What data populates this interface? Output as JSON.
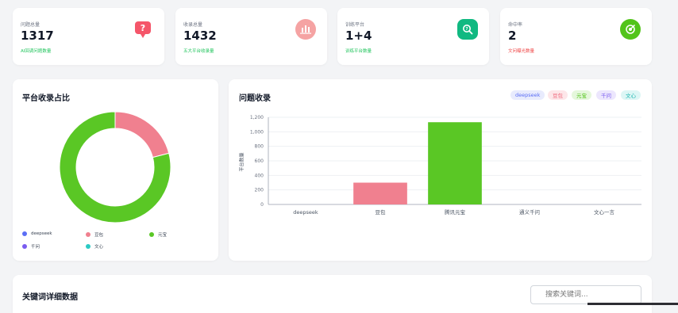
{
  "stats": [
    {
      "label": "问题总量",
      "value": "1317",
      "sub": "AI回调问题数量",
      "sub_color": "#22c55e",
      "icon": "question-bubble-icon",
      "icon_bg": "#f87171"
    },
    {
      "label": "收录总量",
      "value": "1432",
      "sub": "五大平台收录量",
      "sub_color": "#22c55e",
      "icon": "bar-chart-icon",
      "icon_bg": "#f5a3a3"
    },
    {
      "label": "训练平台",
      "value": "1+4",
      "sub": "训练平台数量",
      "sub_color": "#22c55e",
      "icon": "search-icon",
      "icon_bg": "#10b981"
    },
    {
      "label": "命中率",
      "value": "2",
      "sub": "文问曝光数量",
      "sub_color": "#ef4444",
      "icon": "target-icon",
      "icon_bg": "#52c41a"
    }
  ],
  "platform_share": {
    "title": "平台收录占比",
    "legend": [
      {
        "name": "deepseek",
        "color": "#5b6ef5"
      },
      {
        "name": "豆包",
        "color": "#f0808f"
      },
      {
        "name": "元宝",
        "color": "#5ac725"
      },
      {
        "name": "千问",
        "color": "#7a5cf0"
      },
      {
        "name": "文心",
        "color": "#2ccac4"
      }
    ]
  },
  "question_collection": {
    "title": "问题收录",
    "filters": [
      {
        "label": "deepseek",
        "bg": "#e8ebfd",
        "fg": "#5b6ef5"
      },
      {
        "label": "豆包",
        "bg": "#fde6e9",
        "fg": "#ef6a7d"
      },
      {
        "label": "元宝",
        "bg": "#e5f7dc",
        "fg": "#52c41a"
      },
      {
        "label": "千问",
        "bg": "#ece6fd",
        "fg": "#7a5cf0"
      },
      {
        "label": "文心",
        "bg": "#ddf6f5",
        "fg": "#22b8b2"
      }
    ]
  },
  "chart_data": [
    {
      "type": "pie",
      "title": "平台收录占比",
      "categories": [
        "deepseek",
        "豆包",
        "元宝",
        "千问",
        "文心"
      ],
      "values": [
        0,
        300,
        1132,
        0,
        0
      ],
      "colors": [
        "#5b6ef5",
        "#f0808f",
        "#5ac725",
        "#7a5cf0",
        "#2ccac4"
      ],
      "legend": "bottom"
    },
    {
      "type": "bar",
      "title": "问题收录",
      "categories": [
        "deepseek",
        "豆包",
        "腾讯元宝",
        "通义千问",
        "文心一言"
      ],
      "values": [
        0,
        300,
        1132,
        0,
        0
      ],
      "colors": [
        "#5b6ef5",
        "#f0808f",
        "#5ac725",
        "#7a5cf0",
        "#2ccac4"
      ],
      "ylabel": "平台数量",
      "yticks": [
        "0",
        "200",
        "400",
        "600",
        "800",
        "1,000",
        "1,200"
      ],
      "ylim": [
        0,
        1200
      ],
      "grid": true
    }
  ],
  "keywords": {
    "title": "关键词详细数据",
    "search_placeholder": "搜索关键词..."
  }
}
